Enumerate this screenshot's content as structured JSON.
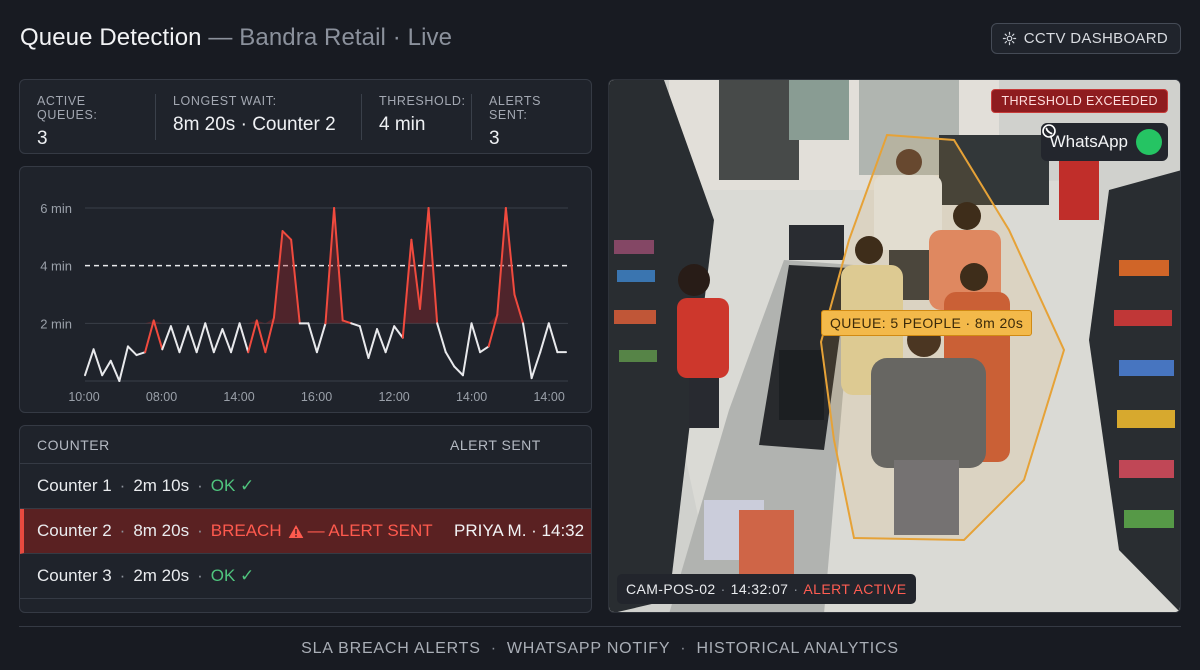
{
  "header": {
    "title": "Queue Detection",
    "subtitle": "— Bandra Retail · Live",
    "button_label": "CCTV DASHBOARD"
  },
  "stats": [
    {
      "label": "ACTIVE QUEUES:",
      "value": "3"
    },
    {
      "label": "LONGEST WAIT:",
      "value": "8m 20s · Counter 2"
    },
    {
      "label": "THRESHOLD:",
      "value": "4 min"
    },
    {
      "label": "ALERTS SENT:",
      "value": "3"
    }
  ],
  "chart_data": {
    "type": "line",
    "ylabel": "",
    "xlabel": "",
    "y_tick_labels": [
      "6 min",
      "4 min",
      "2 min"
    ],
    "x_tick_labels": [
      "10:00",
      "08:00",
      "14:00",
      "16:00",
      "12:00",
      "14:00",
      "14:00"
    ],
    "ylim": [
      0,
      6.5
    ],
    "threshold": 4,
    "grid": true,
    "series": [
      {
        "values": [
          0.2,
          1.1,
          0.2,
          0.7,
          0.0,
          1.2,
          0.9,
          1.0,
          2.1,
          1.1,
          1.9,
          1.0,
          1.9,
          1.0,
          2.0,
          1.0,
          1.8,
          1.0,
          2.0,
          1.0,
          2.1,
          1.0,
          2.2,
          5.2,
          4.9,
          2.0,
          2.0,
          1.0,
          2.0,
          6.0,
          2.1,
          2.0,
          1.9,
          0.8,
          1.8,
          1.0,
          1.9,
          1.5,
          4.9,
          2.5,
          6.0,
          2.0,
          1.0,
          0.5,
          0.2,
          2.0,
          1.0,
          1.2,
          2.3,
          6.0,
          3.0,
          2.0,
          0.1,
          1.0,
          2.0,
          1.0,
          1.0
        ]
      }
    ]
  },
  "table": {
    "headers": [
      "COUNTER",
      "ALERT SENT"
    ],
    "rows": [
      {
        "counter": "Counter 1",
        "wait": "2m 10s",
        "status": "OK ✓",
        "alert": ""
      },
      {
        "counter": "Counter 2",
        "wait": "8m 20s",
        "status": "BREACH",
        "status_suffix": "— ALERT SENT",
        "alert": "PRIYA M. · 14:32"
      },
      {
        "counter": "Counter 3",
        "wait": "2m 20s",
        "status": "OK ✓",
        "alert": ""
      }
    ]
  },
  "camera": {
    "threshold_badge": "THRESHOLD EXCEEDED",
    "whatsapp_label": "WhatsApp",
    "queue_label": "QUEUE: 5 PEOPLE  · 8m 20s",
    "cam_id": "CAM-POS-02",
    "timestamp": "14:32:07",
    "status": "ALERT ACTIVE"
  },
  "footer": {
    "items": [
      "SLA BREACH ALERTS",
      "WHATSAPP NOTIFY",
      "HISTORICAL ANALYTICS"
    ]
  },
  "colors": {
    "breach": "#ff5a4e",
    "ok": "#4fc47d",
    "queue_zone": "#f0a93a",
    "line": "#e8e9ec"
  }
}
